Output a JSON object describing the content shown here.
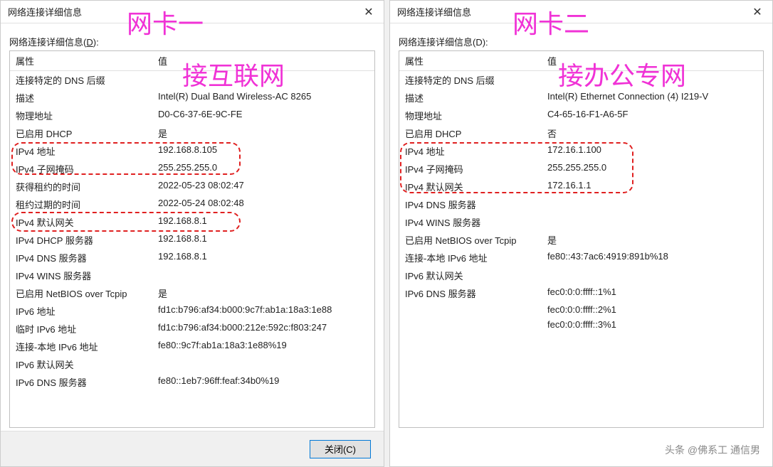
{
  "annotations": {
    "card1": "网卡一",
    "card1_sub": "接互联网",
    "card2": "网卡二",
    "card2_sub": "接办公专网"
  },
  "left": {
    "title": "网络连接详细信息",
    "section_label": "网络连接详细信息(",
    "section_key": "D",
    "section_tail": "):",
    "col_prop": "属性",
    "col_val": "值",
    "close_label": "关闭(C)",
    "rows": [
      {
        "p": "连接特定的 DNS 后缀",
        "v": ""
      },
      {
        "p": "描述",
        "v": "Intel(R) Dual Band Wireless-AC 8265"
      },
      {
        "p": "物理地址",
        "v": "D0-C6-37-6E-9C-FE"
      },
      {
        "p": "已启用 DHCP",
        "v": "是"
      },
      {
        "p": "IPv4 地址",
        "v": "192.168.8.105"
      },
      {
        "p": "IPv4 子网掩码",
        "v": "255.255.255.0"
      },
      {
        "p": "获得租约的时间",
        "v": "2022-05-23 08:02:47"
      },
      {
        "p": "租约过期的时间",
        "v": "2022-05-24 08:02:48"
      },
      {
        "p": "IPv4 默认网关",
        "v": "192.168.8.1"
      },
      {
        "p": "IPv4 DHCP 服务器",
        "v": "192.168.8.1"
      },
      {
        "p": "IPv4 DNS 服务器",
        "v": "192.168.8.1"
      },
      {
        "p": "IPv4 WINS 服务器",
        "v": ""
      },
      {
        "p": "已启用 NetBIOS over Tcpip",
        "v": "是"
      },
      {
        "p": "IPv6 地址",
        "v": "fd1c:b796:af34:b000:9c7f:ab1a:18a3:1e88"
      },
      {
        "p": "临时 IPv6 地址",
        "v": "fd1c:b796:af34:b000:212e:592c:f803:247"
      },
      {
        "p": "连接-本地 IPv6 地址",
        "v": "fe80::9c7f:ab1a:18a3:1e88%19"
      },
      {
        "p": "IPv6 默认网关",
        "v": ""
      },
      {
        "p": "IPv6 DNS 服务器",
        "v": "fe80::1eb7:96ff:feaf:34b0%19"
      }
    ]
  },
  "right": {
    "title": "网络连接详细信息",
    "section_label": "网络连接详细信息(D):",
    "col_prop": "属性",
    "col_val": "值",
    "rows": [
      {
        "p": "连接特定的 DNS 后缀",
        "v": ""
      },
      {
        "p": "描述",
        "v": "Intel(R) Ethernet Connection (4) I219-V"
      },
      {
        "p": "物理地址",
        "v": "C4-65-16-F1-A6-5F"
      },
      {
        "p": "已启用 DHCP",
        "v": "否"
      },
      {
        "p": "IPv4 地址",
        "v": "172.16.1.100"
      },
      {
        "p": "IPv4 子网掩码",
        "v": "255.255.255.0"
      },
      {
        "p": "IPv4 默认网关",
        "v": "172.16.1.1"
      },
      {
        "p": "IPv4 DNS 服务器",
        "v": ""
      },
      {
        "p": "IPv4 WINS 服务器",
        "v": ""
      },
      {
        "p": "已启用 NetBIOS over Tcpip",
        "v": "是"
      },
      {
        "p": "连接-本地 IPv6 地址",
        "v": "fe80::43:7ac6:4919:891b%18"
      },
      {
        "p": "IPv6 默认网关",
        "v": ""
      },
      {
        "p": "IPv6 DNS 服务器",
        "v": "fec0:0:0:ffff::1%1"
      },
      {
        "p": "",
        "v": "fec0:0:0:ffff::2%1"
      },
      {
        "p": "",
        "v": "fec0:0:0:ffff::3%1"
      }
    ]
  },
  "watermark": "头条 @佛系工 通信男"
}
